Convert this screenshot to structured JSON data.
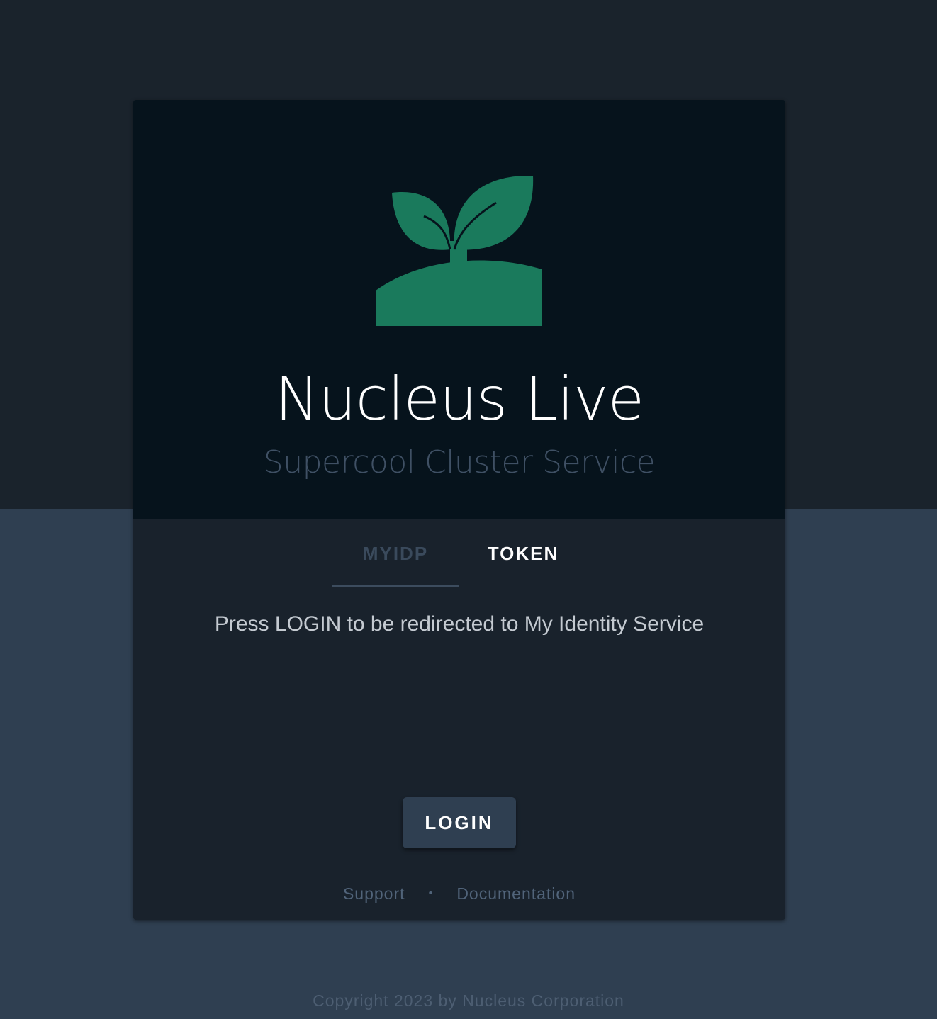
{
  "brand": {
    "title": "Nucleus Live",
    "subtitle": "Supercool Cluster Service",
    "logo_icon": "sprout-icon",
    "logo_color": "#1a7a5c"
  },
  "tabs": [
    {
      "label": "MYIDP",
      "selected": false
    },
    {
      "label": "TOKEN",
      "selected": true
    }
  ],
  "main": {
    "info_text": "Press LOGIN to be redirected to My Identity Service",
    "login_label": "LOGIN"
  },
  "footer": {
    "support_label": "Support",
    "separator": "•",
    "documentation_label": "Documentation",
    "copyright": "Copyright 2023 by Nucleus Corporation"
  },
  "colors": {
    "background_top": "#1a232c",
    "background_bottom": "#2f3f51",
    "card_header": "#06131c",
    "card_body": "#19222c",
    "button": "#2f3f51"
  }
}
